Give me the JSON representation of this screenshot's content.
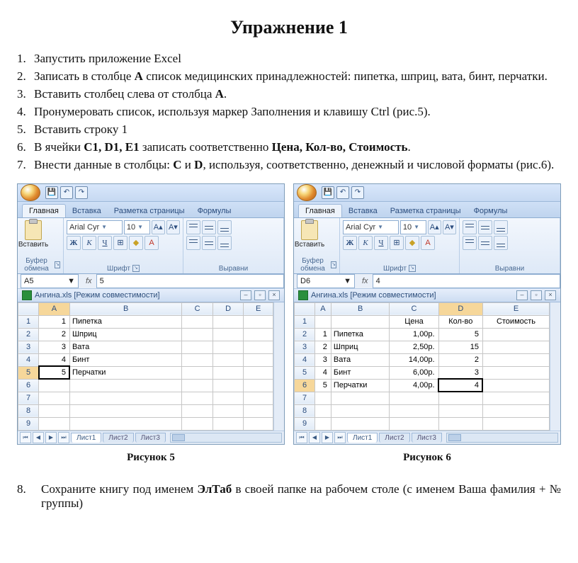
{
  "title": "Упражнение 1",
  "steps": {
    "s1": "Запустить приложение Excel",
    "s2a": "Записать в столбце ",
    "s2b": "A",
    "s2c": " список медицинских принадлежностей: пипетка, шприц, вата, бинт, перчатки.",
    "s3a": "Вставить столбец слева от столбца ",
    "s3b": "A",
    "s3c": ".",
    "s4": "Пронумеровать список, используя маркер Заполнения  и клавишу Ctrl (рис.5).",
    "s5": "Вставить строку 1",
    "s6a": "В ячейки ",
    "s6b": "C1, D1, E1",
    "s6c": " записать соответственно ",
    "s6d": "Цена,  Кол-во, Стоимость",
    "s6e": ".",
    "s7a": "Внести данные в столбцы: ",
    "s7b": "C",
    "s7c": " и ",
    "s7d": "D",
    "s7e": ", используя, соответственно, денежный и числовой форматы (рис.6).",
    "s8a": "Сохраните книгу под именем ",
    "s8b": "ЭлТаб",
    "s8c": " в своей папке на рабочем столе (с именем   Ваша фамилия + № группы)"
  },
  "excel": {
    "tabs": {
      "home": "Главная",
      "insert": "Вставка",
      "layout": "Разметка страницы",
      "formulas": "Формулы"
    },
    "groups": {
      "clipboard": "Буфер обмена",
      "font": "Шрифт",
      "align": "Выравни"
    },
    "paste": "Вставить",
    "font": "Arial Cyr",
    "size": "10",
    "bold": "Ж",
    "italic": "К",
    "under": "Ч",
    "wbTitle": "Ангина.xls  [Режим совместимости]",
    "sheets": {
      "s1": "Лист1",
      "s2": "Лист2",
      "s3": "Лист3"
    }
  },
  "fig5": {
    "namebox": "A5",
    "formula": "5",
    "cols": [
      "",
      "A",
      "B",
      "C",
      "D",
      "E"
    ],
    "rows": [
      {
        "r": "1",
        "A": "1",
        "B": "Пипетка"
      },
      {
        "r": "2",
        "A": "2",
        "B": "Шприц"
      },
      {
        "r": "3",
        "A": "3",
        "B": "Вата"
      },
      {
        "r": "4",
        "A": "4",
        "B": "Бинт"
      },
      {
        "r": "5",
        "A": "5",
        "B": "Перчатки",
        "sel": true
      },
      {
        "r": "6"
      },
      {
        "r": "7"
      },
      {
        "r": "8"
      },
      {
        "r": "9"
      }
    ],
    "caption": "Рисунок 5"
  },
  "fig6": {
    "namebox": "D6",
    "formula": "4",
    "cols": [
      "",
      "A",
      "B",
      "C",
      "D",
      "E"
    ],
    "hdr": {
      "C": "Цена",
      "D": "Кол-во",
      "E": "Стоимость"
    },
    "rows": [
      {
        "r": "2",
        "A": "1",
        "B": "Пипетка",
        "C": "1,00р.",
        "D": "5"
      },
      {
        "r": "3",
        "A": "2",
        "B": "Шприц",
        "C": "2,50р.",
        "D": "15"
      },
      {
        "r": "4",
        "A": "3",
        "B": "Вата",
        "C": "14,00р.",
        "D": "2"
      },
      {
        "r": "5",
        "A": "4",
        "B": "Бинт",
        "C": "6,00р.",
        "D": "3"
      },
      {
        "r": "6",
        "A": "5",
        "B": "Перчатки",
        "C": "4,00р.",
        "D": "4",
        "sel": true
      },
      {
        "r": "7"
      },
      {
        "r": "8"
      },
      {
        "r": "9"
      }
    ],
    "caption": "Рисунок 6"
  }
}
